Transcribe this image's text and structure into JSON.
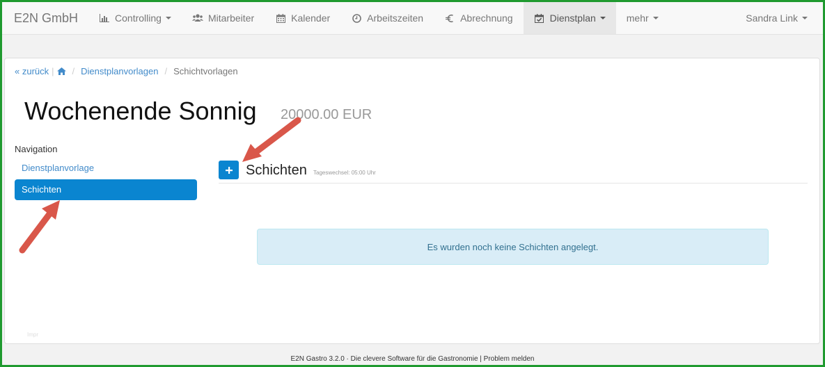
{
  "navbar": {
    "brand": "E2N GmbH",
    "items": [
      {
        "label": "Controlling",
        "icon": "bar-chart-icon",
        "dropdown": true
      },
      {
        "label": "Mitarbeiter",
        "icon": "users-icon",
        "dropdown": false
      },
      {
        "label": "Kalender",
        "icon": "calendar-icon",
        "dropdown": false
      },
      {
        "label": "Arbeitszeiten",
        "icon": "clock-icon",
        "dropdown": false
      },
      {
        "label": "Abrechnung",
        "icon": "euro-icon",
        "dropdown": false
      },
      {
        "label": "Dienstplan",
        "icon": "calendar-check-icon",
        "dropdown": true,
        "active": true
      },
      {
        "label": "mehr",
        "icon": "",
        "dropdown": true
      }
    ],
    "user": "Sandra Link"
  },
  "breadcrumb": {
    "back": "zurück",
    "parent": "Dienstplanvorlagen",
    "current": "Schichtvorlagen"
  },
  "page": {
    "title": "Wochenende Sonnig",
    "amount": "20000.00 EUR"
  },
  "sidebar": {
    "heading": "Navigation",
    "items": [
      {
        "label": "Dienstplanvorlage",
        "active": false
      },
      {
        "label": "Schichten",
        "active": true
      }
    ]
  },
  "section": {
    "add_label": "+",
    "title": "Schichten",
    "note": "Tageswechsel: 05:00 Uhr"
  },
  "alert": {
    "message": "Es wurden noch keine Schichten angelegt."
  },
  "footer": {
    "text": "E2N Gastro 3.2.0 · Die clevere Software für die Gastronomie | Problem melden"
  },
  "colors": {
    "primary": "#0a85d0",
    "link": "#428bca",
    "alert_bg": "#d9edf7",
    "arrow": "#d9574a",
    "frame": "#1f9a2f"
  }
}
